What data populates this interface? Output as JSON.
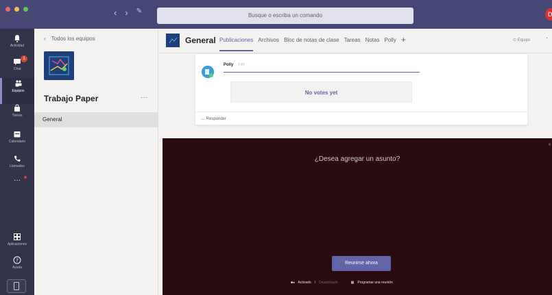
{
  "topbar": {
    "search_placeholder": "Busque o escriba un comando",
    "avatar_initial": "D"
  },
  "rail": {
    "items": [
      {
        "label": "Actividad",
        "icon": "bell-icon"
      },
      {
        "label": "Chat",
        "icon": "chat-icon",
        "badge": "1"
      },
      {
        "label": "Equipos",
        "icon": "teams-icon",
        "active": true
      },
      {
        "label": "Tareas",
        "icon": "bag-icon"
      },
      {
        "label": "Calendario",
        "icon": "calendar-icon"
      },
      {
        "label": "Llamadas",
        "icon": "phone-icon"
      },
      {
        "label": "",
        "icon": "more-icon"
      }
    ],
    "bottom": [
      {
        "label": "Aplicaciones",
        "icon": "apps-icon"
      },
      {
        "label": "Ayuda",
        "icon": "help-icon"
      }
    ]
  },
  "teams_panel": {
    "back_label": "Todos los equipos",
    "team_name": "Trabajo Paper",
    "more": "···",
    "channels": [
      {
        "name": "General",
        "selected": true
      }
    ]
  },
  "channel": {
    "title": "General",
    "tabs": [
      {
        "label": "Publicaciones",
        "active": true
      },
      {
        "label": "Archivos"
      },
      {
        "label": "Bloc de notas de clase"
      },
      {
        "label": "Tareas"
      },
      {
        "label": "Notas"
      },
      {
        "label": "Polly"
      }
    ],
    "add_tab": "+",
    "team_button": "⊙ Equipo"
  },
  "post": {
    "author": "Polly",
    "time": "7:47",
    "vote_text": "No votes yet",
    "reply_label": "← Responder"
  },
  "meeting": {
    "subject_prompt": "¿Desea agregar un asunto?",
    "join_label": "Reunirse ahora",
    "video_on": "Activado",
    "separator": "/",
    "video_off": "Desactivado",
    "schedule_label": "Programar una reunión"
  },
  "colors": {
    "accent": "#6264a7",
    "topbar": "#464775",
    "rail": "#33344a",
    "meeting_bg": "#2a0c10"
  }
}
